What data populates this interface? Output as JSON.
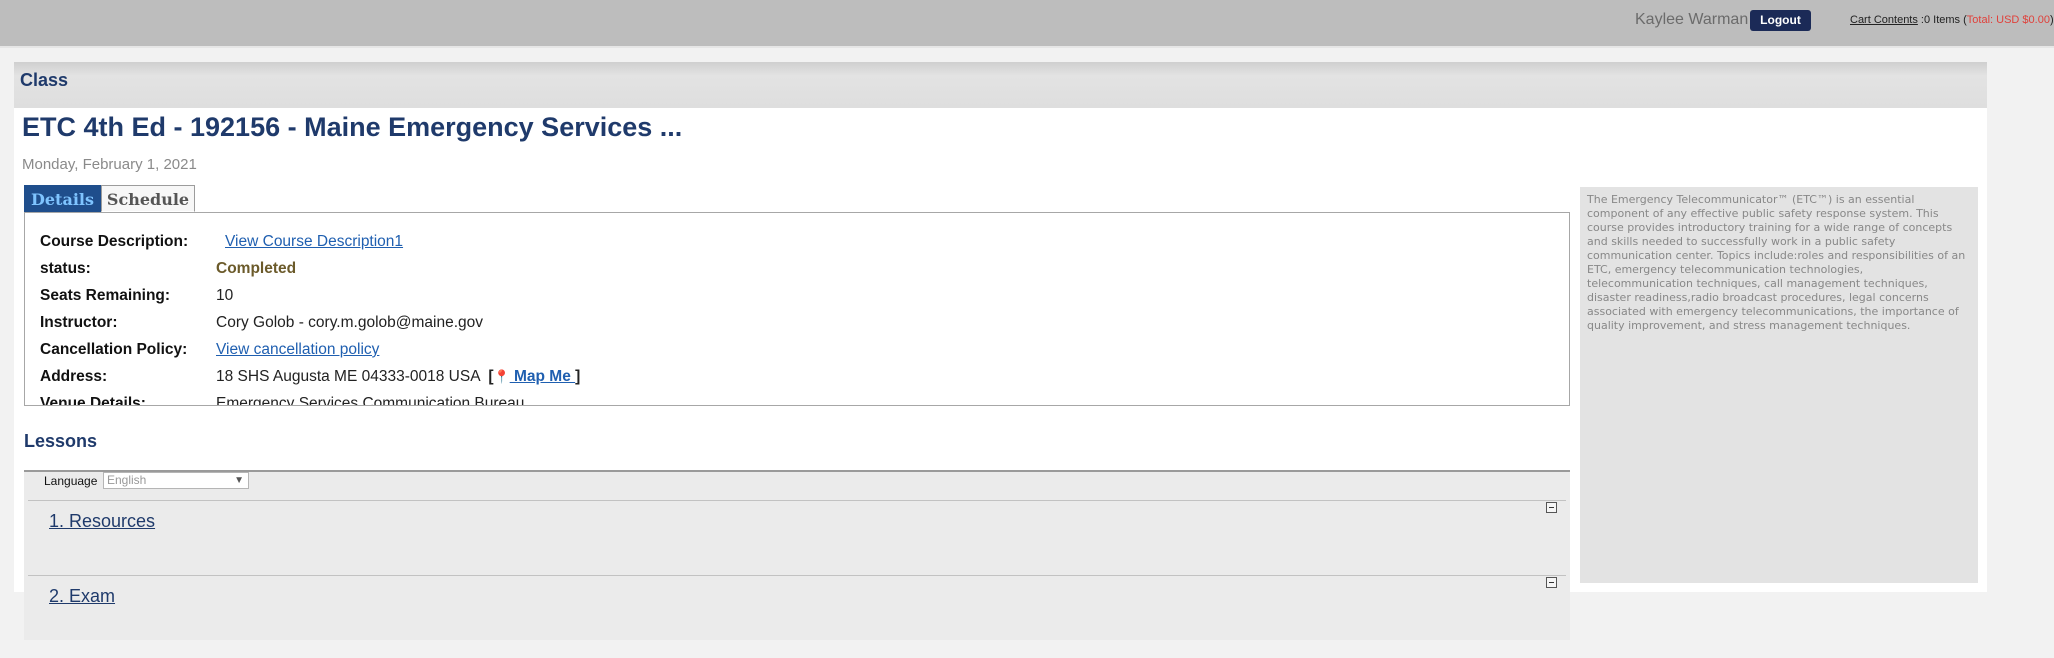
{
  "header": {
    "user_name": "Kaylee Warman",
    "logout_label": "Logout",
    "cart_link": "Cart Contents",
    "cart_items": " :0 Items (",
    "cart_total": "Total: USD $0.00",
    "cart_close": ")"
  },
  "section": {
    "title": "Class"
  },
  "course": {
    "title": "ETC 4th Ed - 192156 - Maine Emergency Services ...",
    "date": "Monday, February 1, 2021"
  },
  "tabs": [
    {
      "label": "Details",
      "active": true
    },
    {
      "label": "Schedule",
      "active": false
    }
  ],
  "details": {
    "course_description_label": "Course Description:",
    "course_description_link": "View Course Description1",
    "status_label": "status:",
    "status_value": "Completed",
    "seats_label": "Seats Remaining:",
    "seats_value": "10",
    "instructor_label": "Instructor:",
    "instructor_value": "Cory Golob - cory.m.golob@maine.gov",
    "cancellation_label": "Cancellation Policy:",
    "cancellation_link": "View cancellation policy",
    "address_label": "Address:",
    "address_value": "18 SHS Augusta ME 04333-0018 USA",
    "bracket_open": "[",
    "map_me": " Map Me ",
    "bracket_close": "]",
    "venue_label": "Venue Details:",
    "venue_value": "Emergency Services Communication Bureau"
  },
  "description_text": "The Emergency Telecommunicator™ (ETC™) is an essential component of any effective public safety response system. This course provides introductory training for a wide range of concepts and skills needed to successfully work in a public safety communication center. Topics include:roles and responsibilities of an ETC, emergency telecommunication technologies, telecommunication techniques, call management techniques, disaster readiness,radio broadcast procedures, legal concerns associated with emergency telecommunications, the importance of quality improvement, and stress management techniques.",
  "lessons": {
    "title": "Lessons",
    "language_label": "Language",
    "language_value": "English",
    "items": [
      {
        "label": "1. Resources"
      },
      {
        "label": "2. Exam"
      }
    ]
  },
  "icons": {
    "map_pin": "map-pin-icon",
    "collapse": "collapse-icon",
    "dropdown": "chevron-down-icon"
  },
  "colors": {
    "title_blue": "#1f3a6b",
    "link_blue": "#1f5fb0",
    "tab_active": "#1f4e8c",
    "logout_bg": "#1b2a57",
    "total_red": "#e0413b"
  }
}
